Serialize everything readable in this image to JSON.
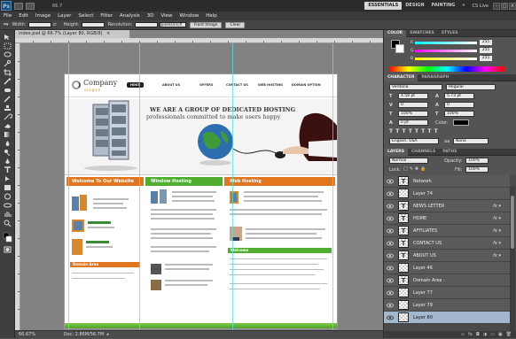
{
  "app": {
    "logo": "Ps",
    "zoom": "66.7",
    "workspaces": [
      "ESSENTIALS",
      "DESIGN",
      "PAINTING",
      "»"
    ],
    "active_workspace": "ESSENTIALS",
    "cs_live": "CS Live"
  },
  "menu": [
    "File",
    "Edit",
    "Image",
    "Layer",
    "Select",
    "Filter",
    "Analysis",
    "3D",
    "View",
    "Window",
    "Help"
  ],
  "options": {
    "width_label": "Width:",
    "height_label": "Height:",
    "resolution_label": "Resolution:",
    "resolution_unit": "pixels/inch",
    "front_image": "Front Image",
    "clear": "Clear"
  },
  "document": {
    "tab_title": "index.psd @ 66.7% (Layer 80, RGB/8)",
    "status_zoom": "66.67%",
    "status_doc": "Doc: 2.86M/56.7M"
  },
  "webpage": {
    "brand": "Company",
    "tagline": "slogan",
    "nav": [
      "HOST",
      "ABOUT US",
      "OFFERS",
      "CONTACT US",
      "WEB HOSTING",
      "DOMAIN OPTION"
    ],
    "hero_line1": "WE ARE A GROUP OF DEDICATED HOSTING",
    "hero_line2": "professionals committed to make users happy",
    "col1_title": "Welcome To Our Website",
    "col2_title": "Window Hosting",
    "col3_title": "Web Hosting",
    "domain_area": "Domain Area",
    "col3_sub": "Welcome"
  },
  "color_panel": {
    "tabs": [
      "COLOR",
      "SWATCHES",
      "STYLES"
    ],
    "r": "255",
    "g": "255",
    "b": "255"
  },
  "character_panel": {
    "tabs": [
      "CHARACTER",
      "PARAGRAPH"
    ],
    "font": "Verdana",
    "style": "Regular",
    "size": "4.58 pt",
    "leading": "5.73 pt",
    "tracking": "0",
    "kerning": "0",
    "vscale": "100%",
    "hscale": "100%",
    "baseline": "0 pt",
    "color_label": "Color:",
    "language": "English: USA",
    "aa": "None",
    "aa_prefix": "aa"
  },
  "layers_panel": {
    "tabs": [
      "LAYERS",
      "CHANNELS",
      "PATHS"
    ],
    "blend": "Normal",
    "opacity_label": "Opacity:",
    "opacity": "100%",
    "lock_label": "Lock:",
    "fill_label": "Fill:",
    "fill": "100%",
    "layers": [
      {
        "name": "Network",
        "type": "T",
        "fx": false,
        "sel": false
      },
      {
        "name": "Layer 74",
        "type": "",
        "fx": false,
        "sel": false
      },
      {
        "name": "NEWS LETTER",
        "type": "T",
        "fx": true,
        "sel": false
      },
      {
        "name": "HOME",
        "type": "T",
        "fx": true,
        "sel": false
      },
      {
        "name": "AFFILIATES",
        "type": "T",
        "fx": true,
        "sel": false
      },
      {
        "name": "CONTACT US",
        "type": "T",
        "fx": true,
        "sel": false
      },
      {
        "name": "ABOUT US",
        "type": "T",
        "fx": true,
        "sel": false
      },
      {
        "name": "Layer 46",
        "type": "",
        "fx": false,
        "sel": false
      },
      {
        "name": "Domain Area :",
        "type": "T",
        "fx": false,
        "sel": false
      },
      {
        "name": "Layer 77",
        "type": "",
        "fx": false,
        "sel": false
      },
      {
        "name": "Layer 79",
        "type": "",
        "fx": false,
        "sel": false
      },
      {
        "name": "Layer 80",
        "type": "",
        "fx": false,
        "sel": true
      }
    ]
  }
}
